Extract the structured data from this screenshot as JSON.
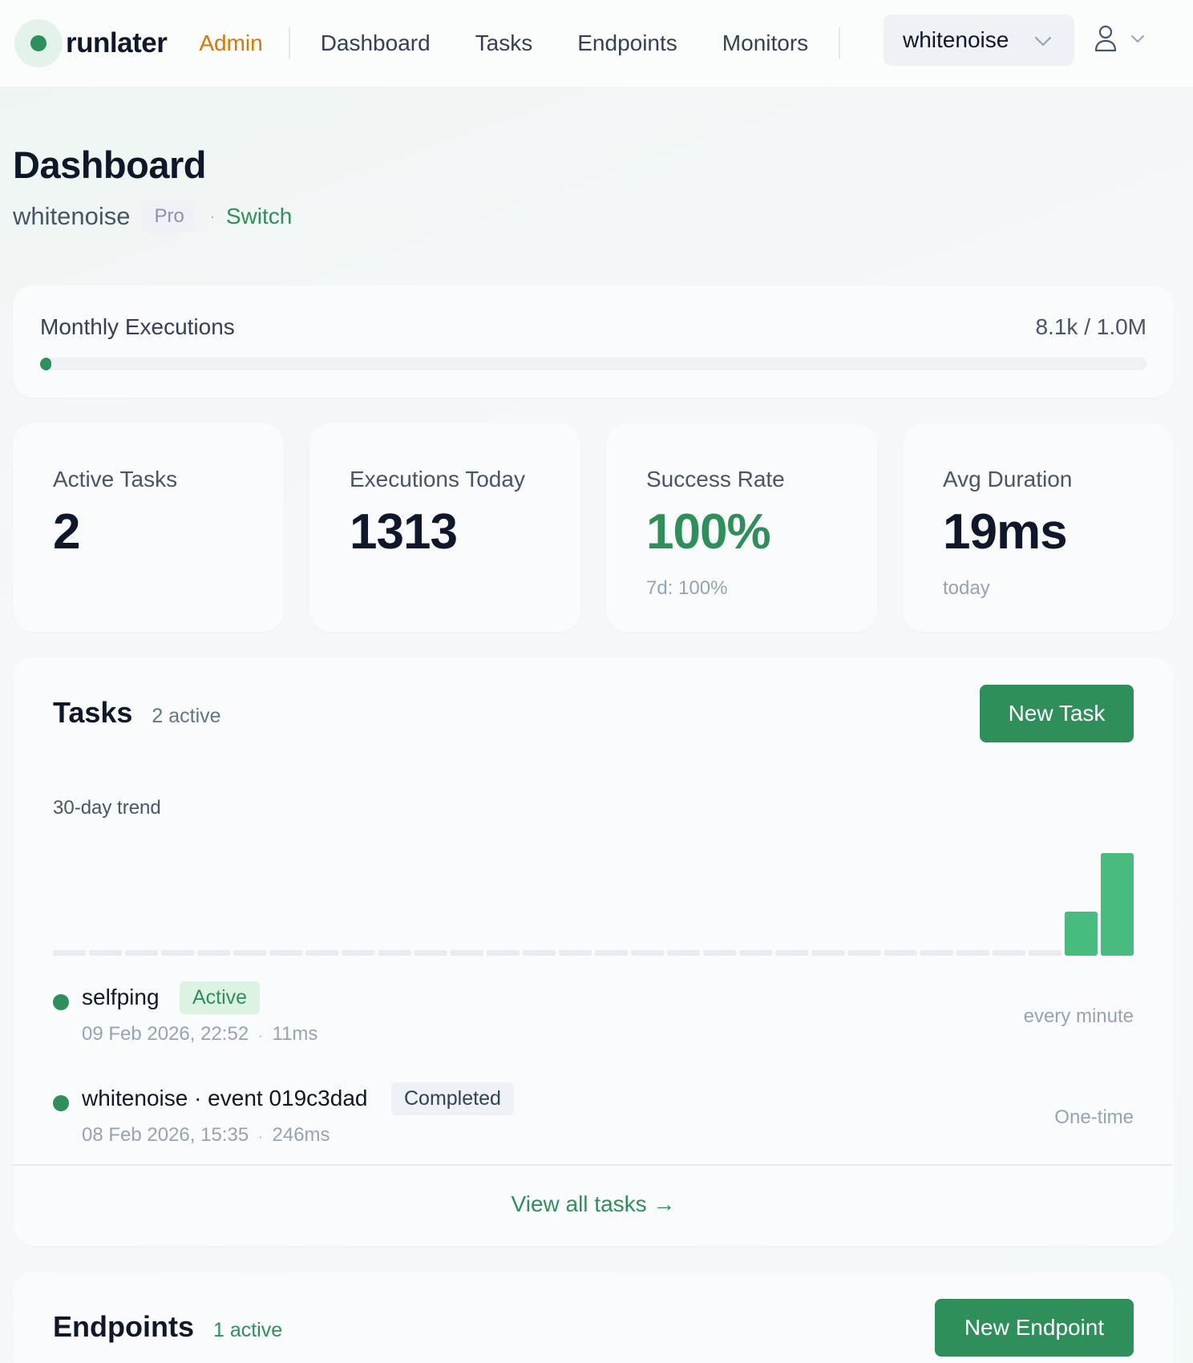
{
  "brand": {
    "name": "runlater"
  },
  "nav": {
    "admin": "Admin",
    "links": [
      "Dashboard",
      "Tasks",
      "Endpoints",
      "Monitors"
    ],
    "org_selected": "whitenoise"
  },
  "header": {
    "title": "Dashboard",
    "org_name": "whitenoise",
    "plan": "Pro",
    "separator": "·",
    "switch_label": "Switch"
  },
  "usage": {
    "label": "Monthly Executions",
    "value_text": "8.1k / 1.0M",
    "used": 8100,
    "limit": 1000000
  },
  "stats": [
    {
      "label": "Active Tasks",
      "value": "2",
      "sub": ""
    },
    {
      "label": "Executions Today",
      "value": "1313",
      "sub": ""
    },
    {
      "label": "Success Rate",
      "value": "100%",
      "sub": "7d: 100%"
    },
    {
      "label": "Avg Duration",
      "value": "19ms",
      "sub": "today"
    }
  ],
  "tasks": {
    "title": "Tasks",
    "count_label": "2 active",
    "new_button": "New Task",
    "trend_label": "30-day trend",
    "items": [
      {
        "name": "selfping",
        "status": "Active",
        "time": "09 Feb 2026, 22:52",
        "sep": "·",
        "duration": "11ms",
        "schedule": "every minute"
      },
      {
        "name": "whitenoise · event 019c3dad",
        "status": "Completed",
        "time": "08 Feb 2026, 15:35",
        "sep": "·",
        "duration": "246ms",
        "schedule": "One-time"
      }
    ],
    "view_all": "View all tasks →"
  },
  "endpoints": {
    "title": "Endpoints",
    "count_label": "1 active",
    "new_button": "New Endpoint"
  },
  "colors": {
    "accent": "#2f8f5b",
    "bar": "#48bb7f",
    "admin": "#d97706",
    "empty_bar": "#e8ecf1"
  },
  "chart_data": {
    "type": "bar",
    "title": "30-day trend",
    "categories": [],
    "values": [
      0,
      0,
      0,
      0,
      0,
      0,
      0,
      0,
      0,
      0,
      0,
      0,
      0,
      0,
      0,
      0,
      0,
      0,
      0,
      0,
      0,
      0,
      0,
      0,
      0,
      0,
      0,
      0,
      0.43,
      1.0
    ],
    "note_scale": "relative",
    "grid": false
  }
}
